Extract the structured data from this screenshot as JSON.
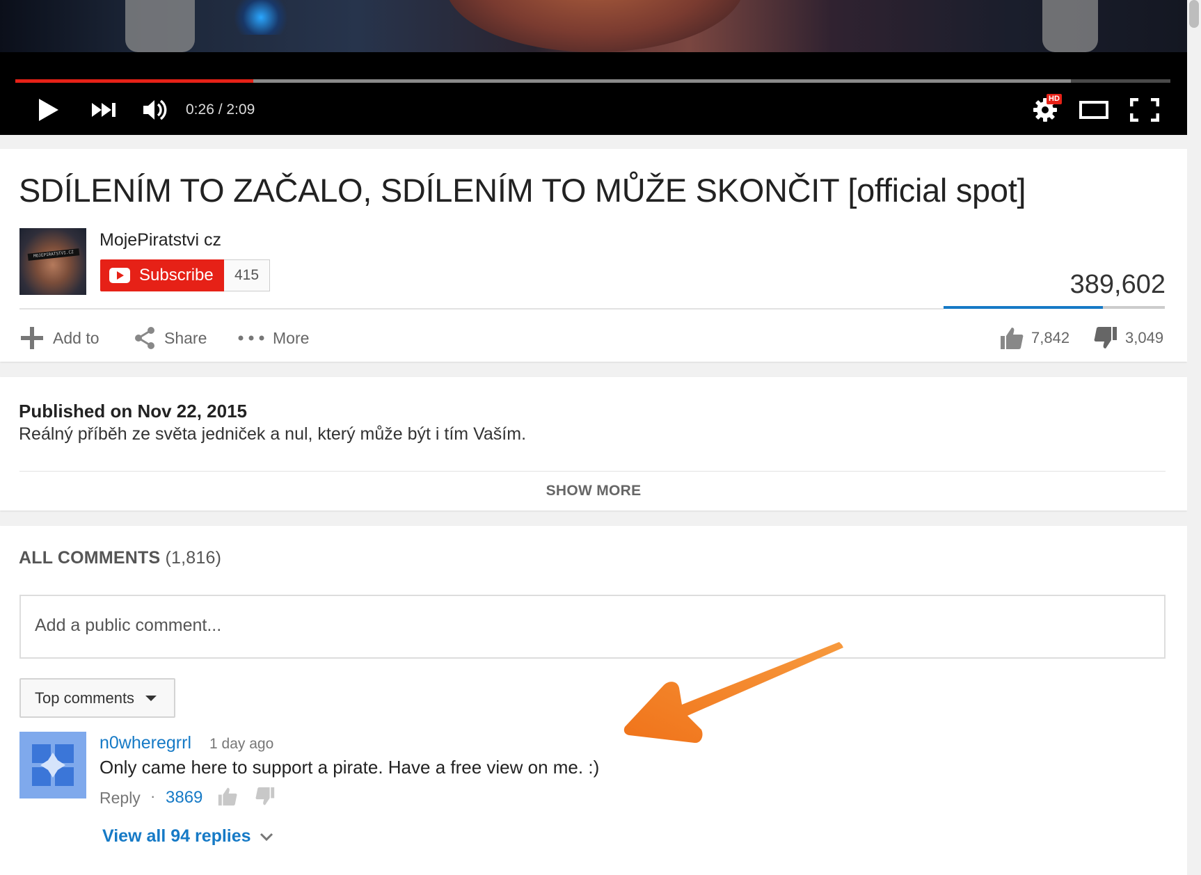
{
  "player": {
    "time_display": "0:26 / 2:09",
    "played_fraction": 0.206,
    "loaded_fraction": 0.914,
    "hd_badge": "HD",
    "progress_color": "#e62117"
  },
  "video": {
    "title": "SDÍLENÍM TO ZAČALO, SDÍLENÍM TO MŮŽE SKONČIT [official spot]",
    "view_count": "389,602",
    "like_count": "7,842",
    "dislike_count": "3,049",
    "like_ratio": 0.72
  },
  "channel": {
    "name": "MojePiratstvi cz",
    "avatar_caption": "MOJEPIRATSTVI.CZ",
    "subscribe_label": "Subscribe",
    "subscriber_count": "415",
    "brand_color": "#e62117"
  },
  "actions": {
    "add_to": "Add to",
    "share": "Share",
    "more": "More"
  },
  "description": {
    "published": "Published on Nov 22, 2015",
    "text": "Reálný příběh ze světa jedniček a nul, který může být i tím Vaším.",
    "show_more": "SHOW MORE"
  },
  "comments": {
    "header": "ALL COMMENTS",
    "count": "(1,816)",
    "input_placeholder": "Add a public comment...",
    "sort_label": "Top comments",
    "link_color": "#167ac6",
    "items": [
      {
        "author": "n0wheregrrl",
        "time": "1 day ago",
        "text": "Only came here to support a pirate.  Have a free view on me.  :)",
        "reply_label": "Reply",
        "separator": "·",
        "likes": "3869",
        "view_replies": "View all 94 replies"
      }
    ]
  },
  "annotation": {
    "arrow_color": "#f47b16",
    "arrow_icon": "arrow-icon"
  }
}
